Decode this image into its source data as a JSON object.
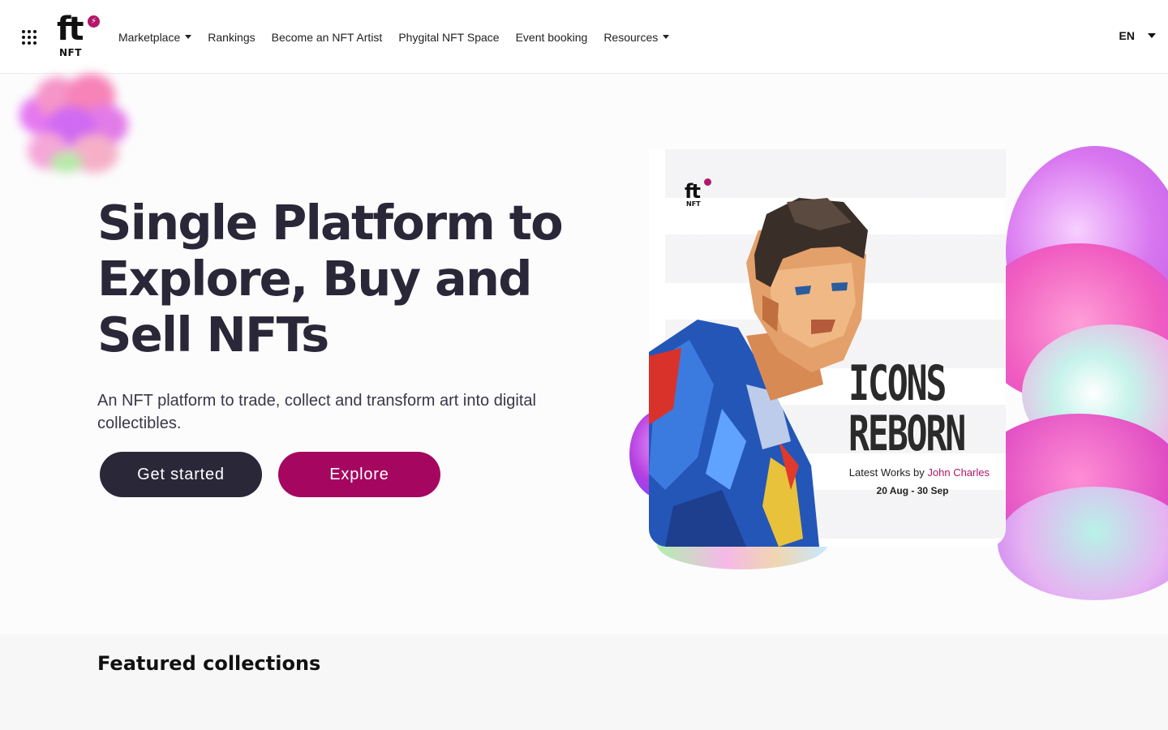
{
  "header": {
    "logo_text": "ft",
    "logo_subtext": "NFT",
    "nav": [
      {
        "label": "Marketplace",
        "has_dropdown": true
      },
      {
        "label": "Rankings",
        "has_dropdown": false
      },
      {
        "label": "Become an NFT Artist",
        "has_dropdown": false
      },
      {
        "label": "Phygital NFT Space",
        "has_dropdown": false
      },
      {
        "label": "Event booking",
        "has_dropdown": false
      },
      {
        "label": "Resources",
        "has_dropdown": true
      }
    ],
    "language": "EN"
  },
  "hero": {
    "title_lines": [
      "Single Platform to",
      "Explore, Buy and",
      "Sell NFTs"
    ],
    "subtitle": "An NFT platform to trade, collect and transform art into digital collectibles.",
    "buttons": {
      "get_started": "Get started",
      "explore": "Explore"
    }
  },
  "featured_card": {
    "logo_text": "ft",
    "logo_subtext": "NFT",
    "title_line1": "ICONS",
    "title_line2": "REBORN",
    "credit_prefix": "Latest Works by",
    "artist": "John Charles",
    "dates": "20 Aug - 30 Sep"
  },
  "featured_section": {
    "title": "Featured collections"
  },
  "colors": {
    "primary_dark": "#2a2738",
    "accent": "#a5065f",
    "brand_badge": "#b3166a"
  },
  "icons": [
    "apps-grid-icon",
    "lightning-icon",
    "chevron-down-icon"
  ]
}
